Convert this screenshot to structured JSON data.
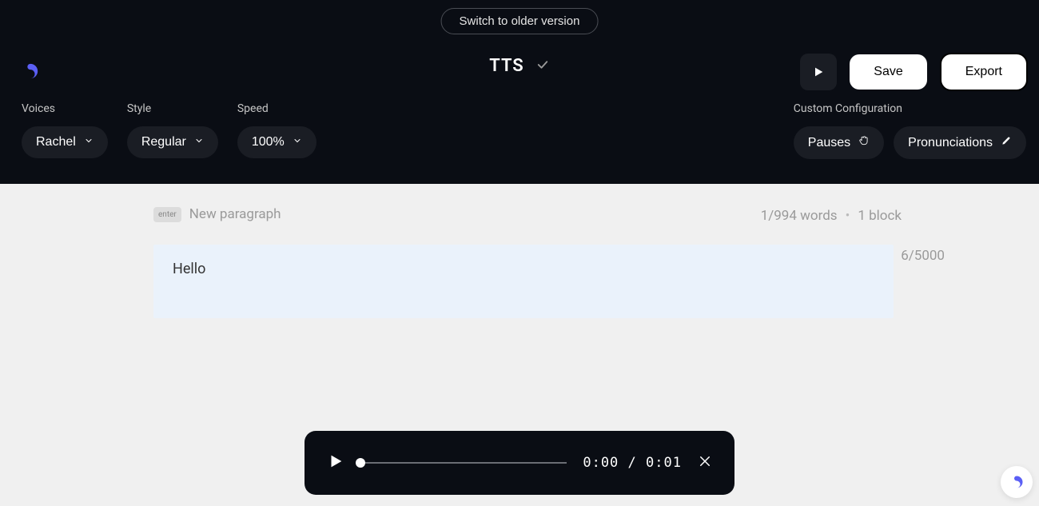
{
  "header": {
    "switch_label": "Switch to older version",
    "title": "TTS",
    "save_label": "Save",
    "export_label": "Export"
  },
  "controls": {
    "voices_label": "Voices",
    "voices_value": "Rachel",
    "style_label": "Style",
    "style_value": "Regular",
    "speed_label": "Speed",
    "speed_value": "100%",
    "custom_config_label": "Custom Configuration",
    "pauses_label": "Pauses",
    "pronunciations_label": "Pronunciations"
  },
  "editor": {
    "enter_key": "enter",
    "hint": "New paragraph",
    "words_stat": "1/994 words",
    "blocks_stat": "1 block",
    "text": "Hello",
    "char_count": "6/5000"
  },
  "player": {
    "current_time": "0:00",
    "separator": "/",
    "total_time": "0:01"
  }
}
